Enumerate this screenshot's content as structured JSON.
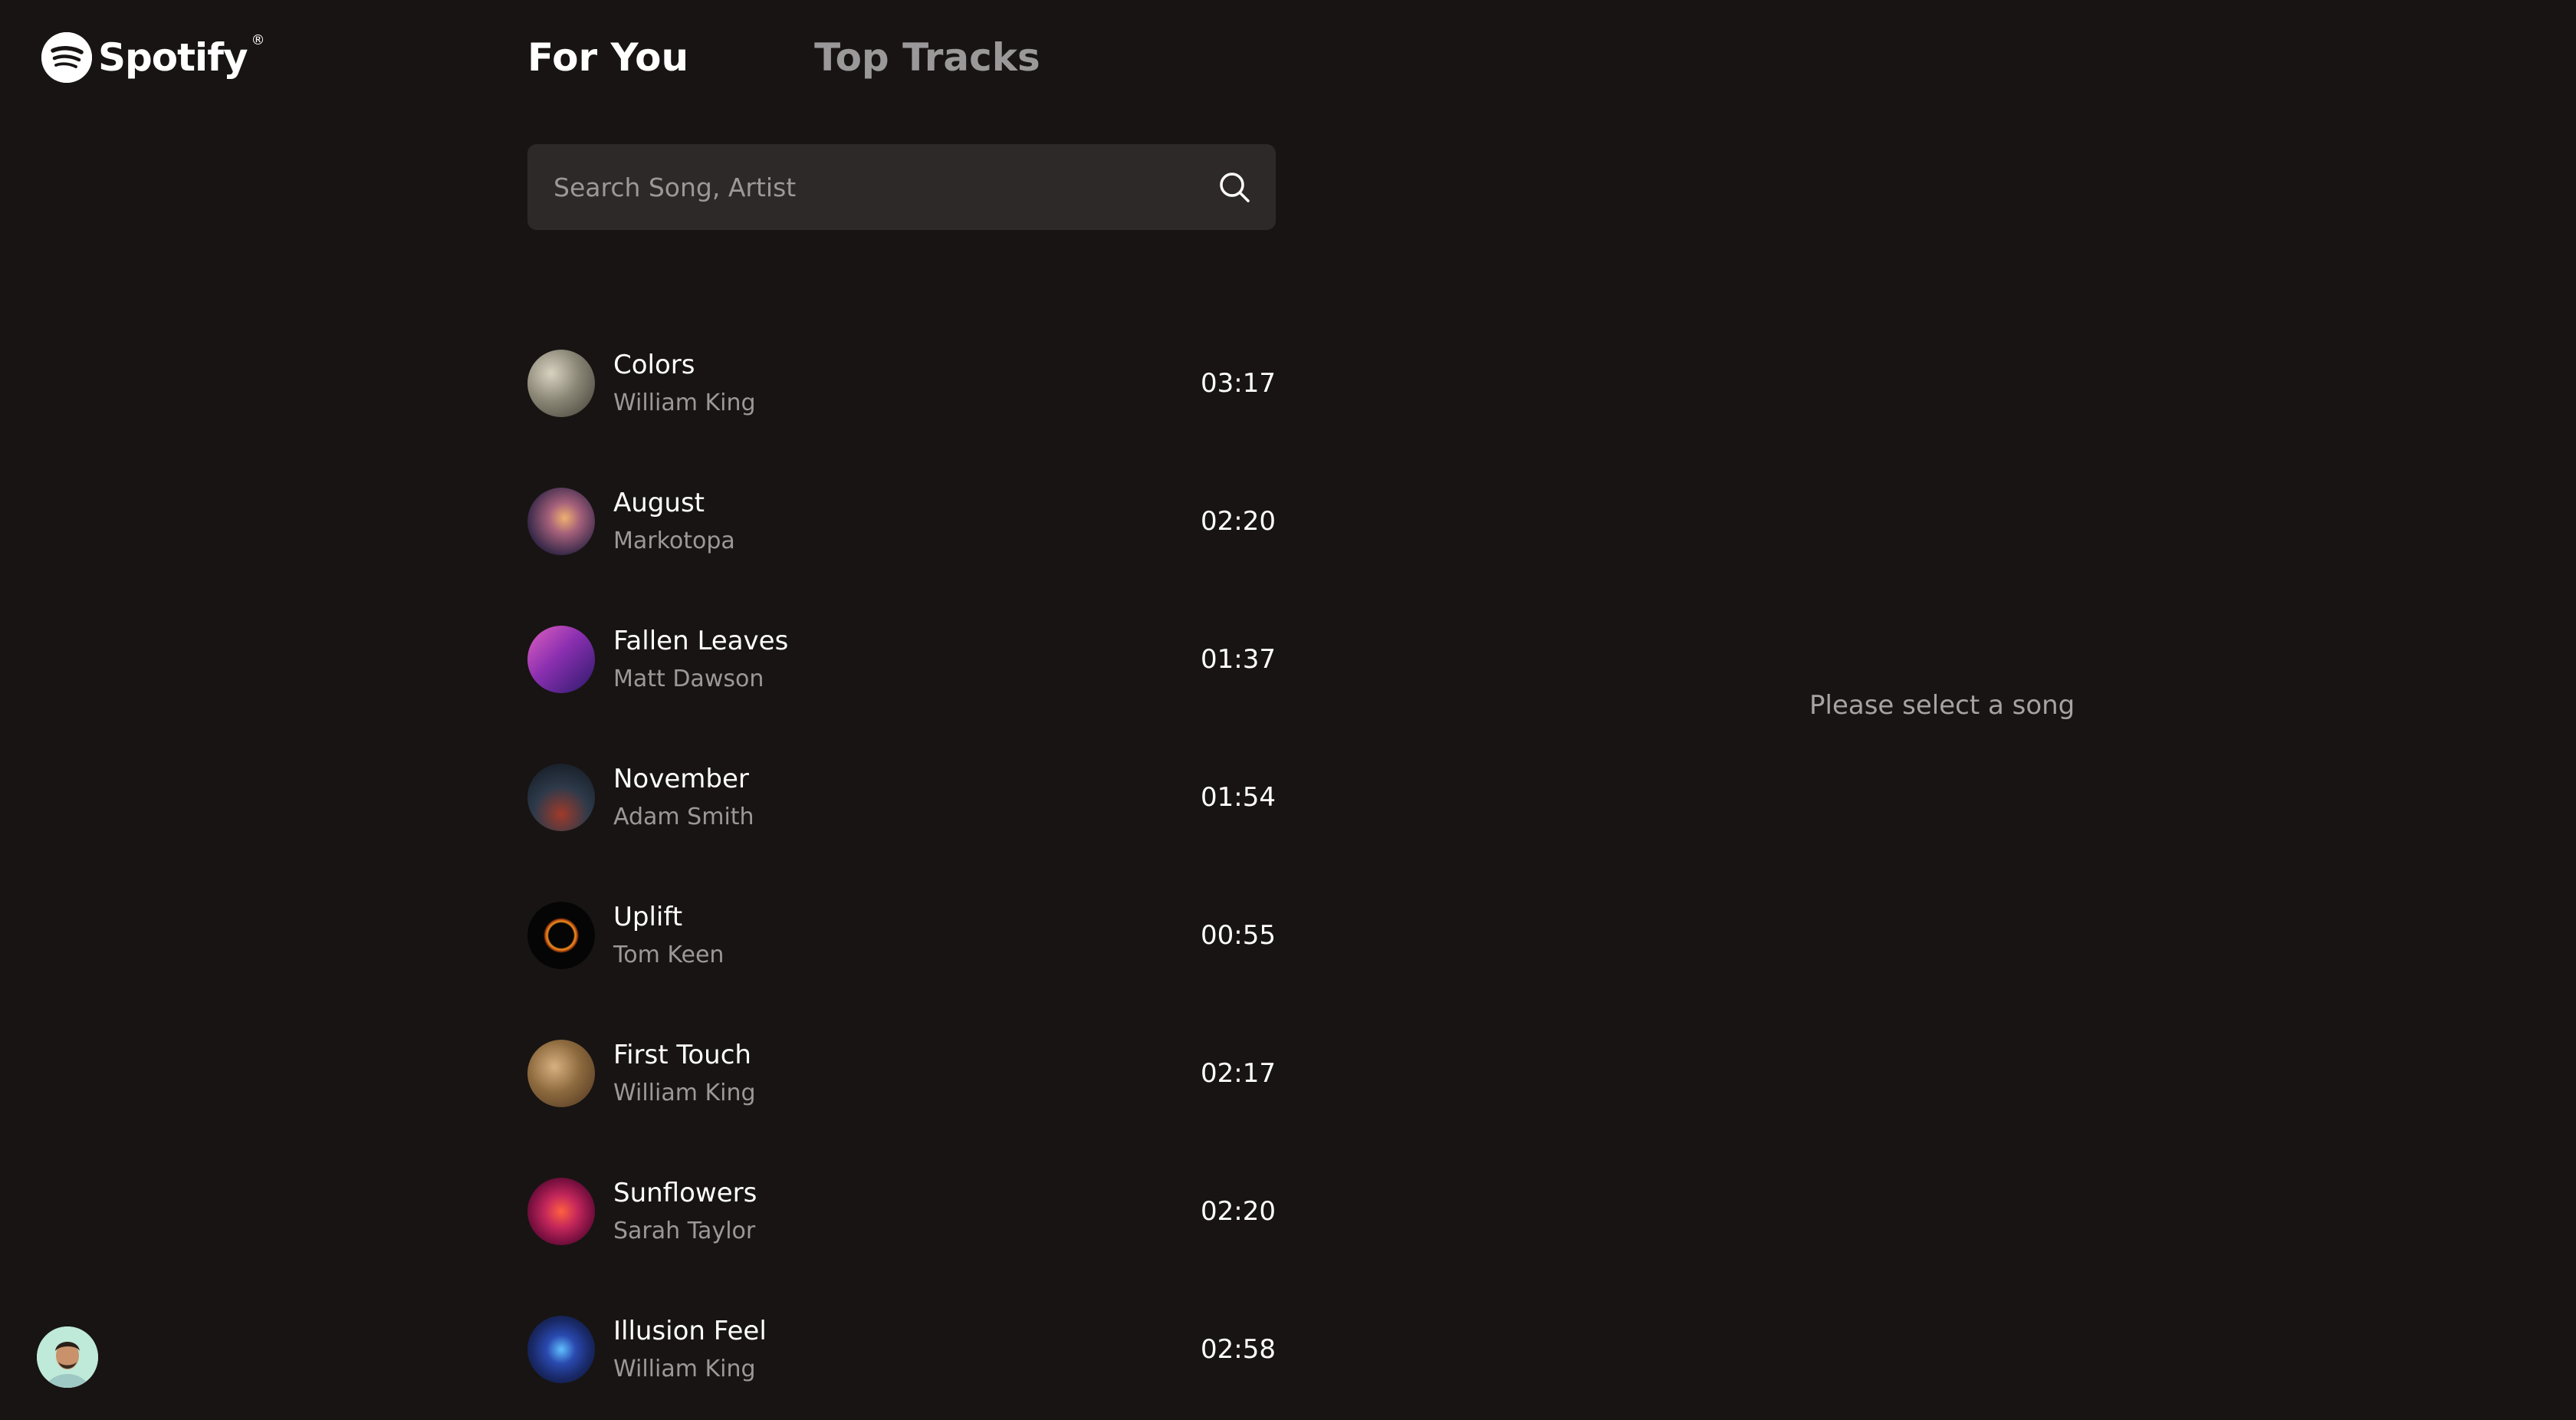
{
  "brand": {
    "name": "Spotify",
    "reg_mark": "®",
    "accent": "#ffffff"
  },
  "nav": {
    "tabs": [
      {
        "label": "For You",
        "active": true
      },
      {
        "label": "Top Tracks",
        "active": false
      }
    ]
  },
  "search": {
    "placeholder": "Search Song, Artist",
    "value": "",
    "icon": "search-icon"
  },
  "tracks": [
    {
      "title": "Colors",
      "artist": "William King",
      "duration": "03:17",
      "cover_color": "#8a8676"
    },
    {
      "title": "August",
      "artist": "Markotopa",
      "duration": "02:20",
      "cover_color": "#6a4a5a"
    },
    {
      "title": "Fallen Leaves",
      "artist": "Matt Dawson",
      "duration": "01:37",
      "cover_color": "#7a2f9a"
    },
    {
      "title": "November",
      "artist": "Adam Smith",
      "duration": "01:54",
      "cover_color": "#2e3a4a"
    },
    {
      "title": "Uplift",
      "artist": "Tom Keen",
      "duration": "00:55",
      "cover_color": "#050505"
    },
    {
      "title": "First Touch",
      "artist": "William King",
      "duration": "02:17",
      "cover_color": "#8d6a3e"
    },
    {
      "title": "Sunflowers",
      "artist": "Sarah Taylor",
      "duration": "02:20",
      "cover_color": "#c2265a"
    },
    {
      "title": "Illusion Feel",
      "artist": "William King",
      "duration": "02:58",
      "cover_color": "#1a2a6a"
    }
  ],
  "player": {
    "empty_message": "Please select a song"
  },
  "user": {
    "avatar_icon": "user-avatar"
  },
  "colors": {
    "background": "#181413",
    "surface": "#2d2928",
    "muted_text": "#9c9897"
  }
}
